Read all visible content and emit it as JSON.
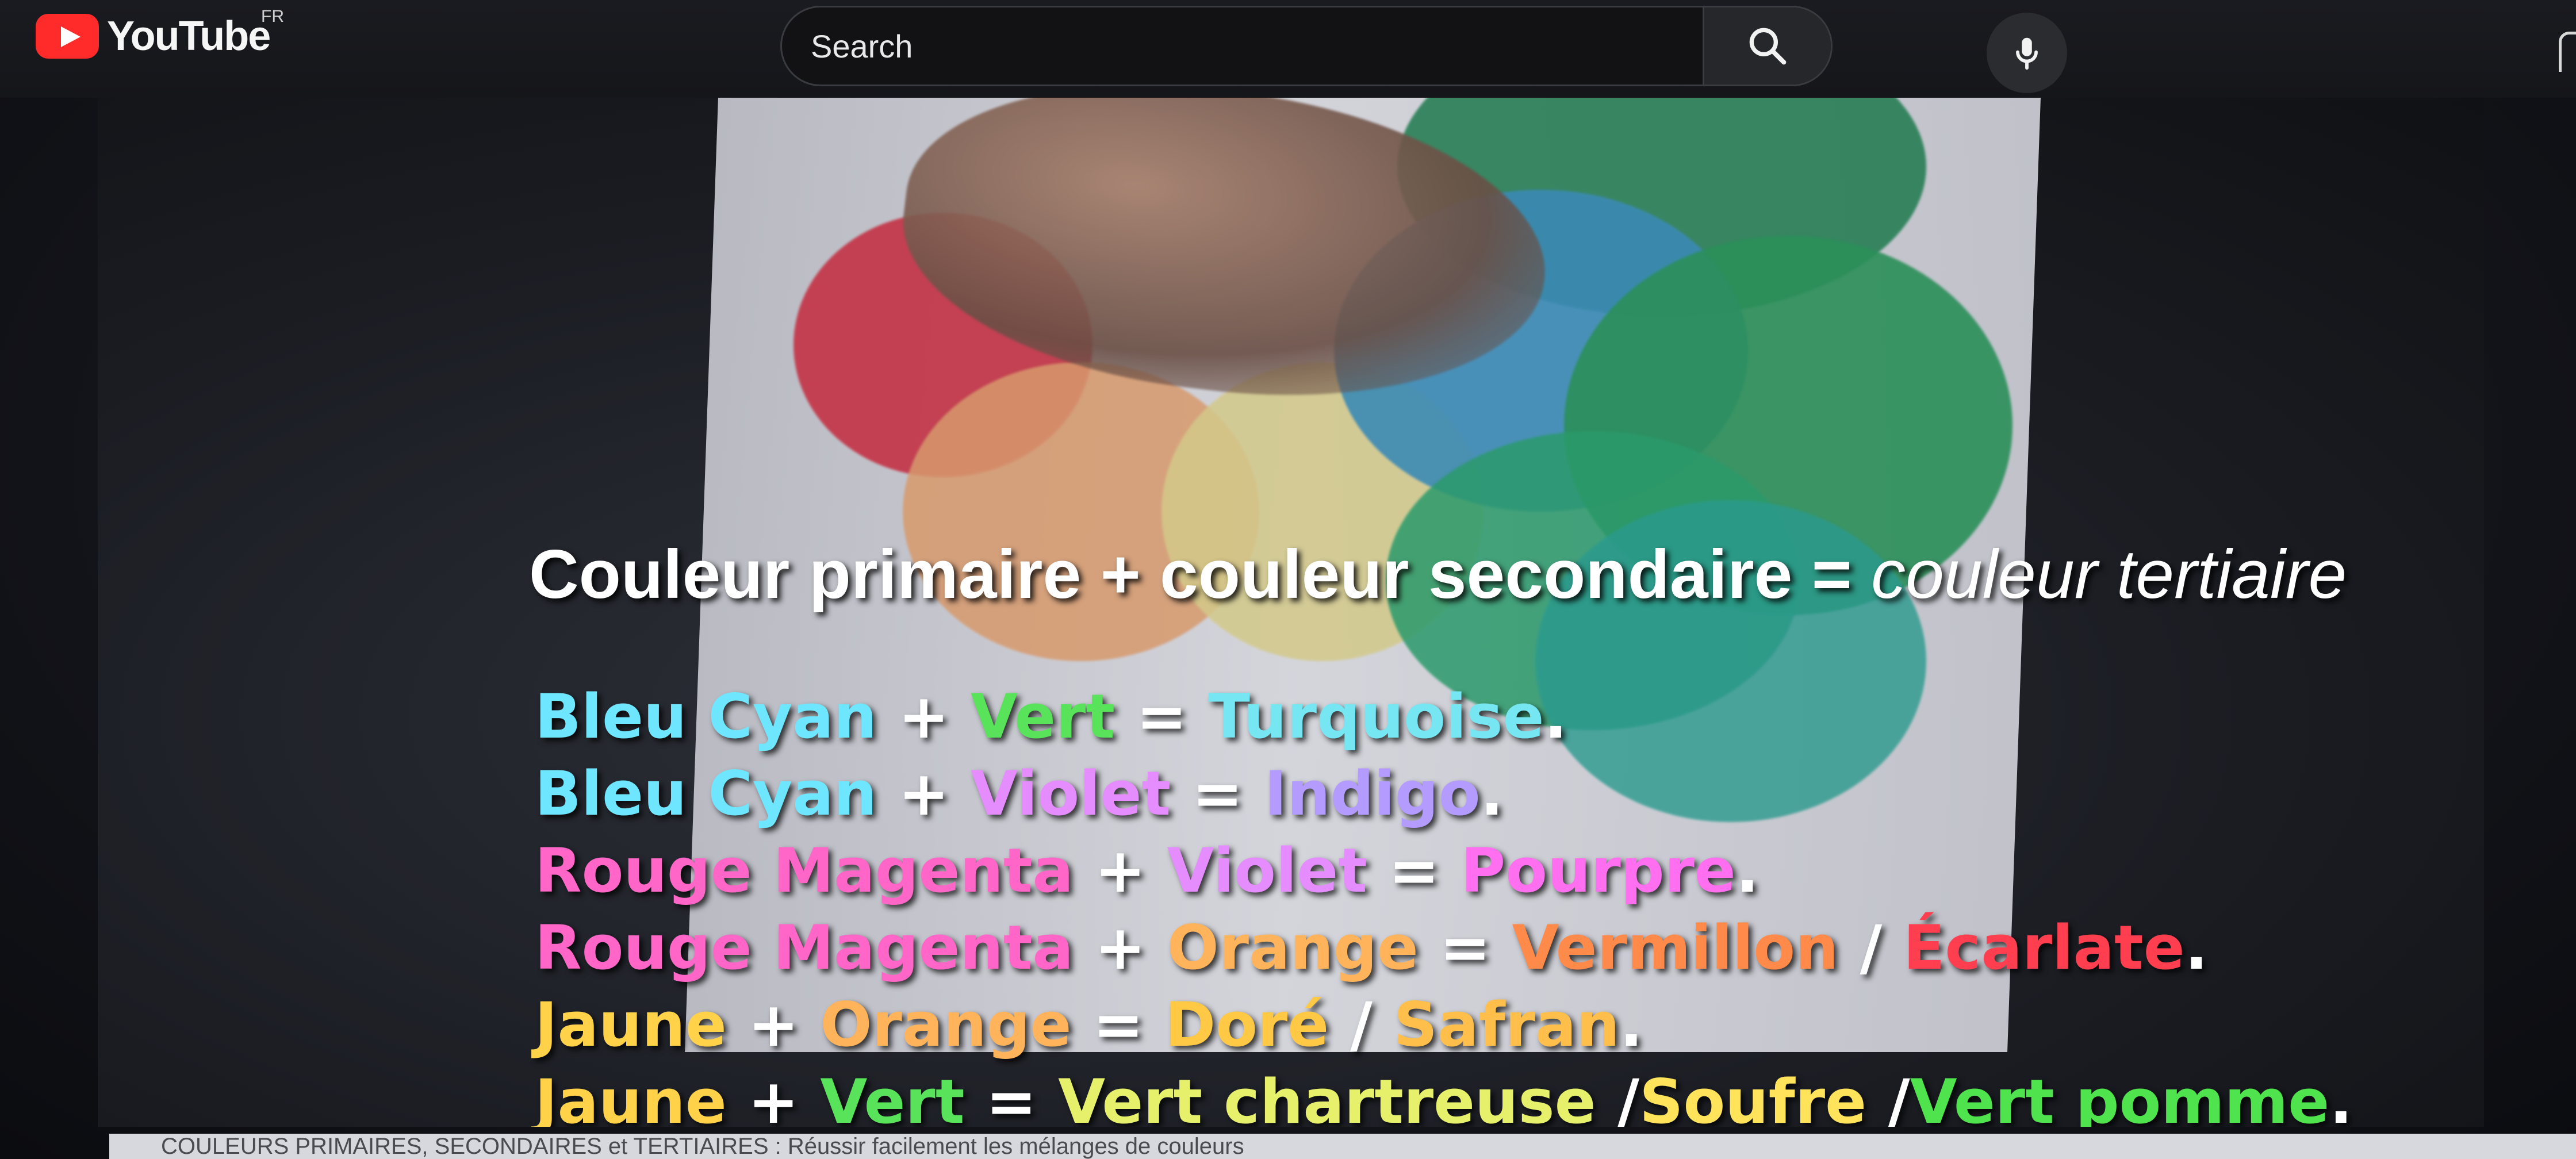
{
  "brand": {
    "name": "YouTube",
    "region": "FR",
    "color": "#ff2a2a"
  },
  "search": {
    "placeholder": "Search",
    "search_icon": "search-icon",
    "voice_icon": "microphone-icon"
  },
  "video": {
    "headline": {
      "part1": "Couleur primaire + couleur secondaire = ",
      "part2": "couleur tertiaire"
    },
    "formulas": [
      {
        "segments": [
          {
            "text": "Bleu Cyan",
            "color": "#6ee6ff"
          },
          {
            "text": " + ",
            "color": "#ffffff"
          },
          {
            "text": "Vert",
            "color": "#58e35a"
          },
          {
            "text": " = ",
            "color": "#ffffff"
          },
          {
            "text": "Turquoise",
            "color": "#76e6f3"
          },
          {
            "text": ".",
            "color": "#ffffff"
          }
        ]
      },
      {
        "segments": [
          {
            "text": "Bleu Cyan",
            "color": "#6ee6ff"
          },
          {
            "text": " + ",
            "color": "#ffffff"
          },
          {
            "text": "Violet",
            "color": "#e58cff"
          },
          {
            "text": " = ",
            "color": "#ffffff"
          },
          {
            "text": "Indigo",
            "color": "#b49bff"
          },
          {
            "text": ".",
            "color": "#ffffff"
          }
        ]
      },
      {
        "segments": [
          {
            "text": "Rouge Magenta",
            "color": "#ff66c8"
          },
          {
            "text": " + ",
            "color": "#ffffff"
          },
          {
            "text": "Violet",
            "color": "#e58cff"
          },
          {
            "text": " = ",
            "color": "#ffffff"
          },
          {
            "text": "Pourpre",
            "color": "#ff6ff0"
          },
          {
            "text": ".",
            "color": "#ffffff"
          }
        ]
      },
      {
        "segments": [
          {
            "text": "Rouge Magenta",
            "color": "#ff66c8"
          },
          {
            "text": " + ",
            "color": "#ffffff"
          },
          {
            "text": "Orange",
            "color": "#ffb35a"
          },
          {
            "text": " = ",
            "color": "#ffffff"
          },
          {
            "text": "Vermillon",
            "color": "#ff8a4a"
          },
          {
            "text": " / ",
            "color": "#ffffff"
          },
          {
            "text": "Écarlate",
            "color": "#ff3f4f"
          },
          {
            "text": ".",
            "color": "#ffffff"
          }
        ]
      },
      {
        "segments": [
          {
            "text": "Jaune",
            "color": "#ffd24a"
          },
          {
            "text": " + ",
            "color": "#ffffff"
          },
          {
            "text": "Orange",
            "color": "#ffb35a"
          },
          {
            "text": " = ",
            "color": "#ffffff"
          },
          {
            "text": "Doré",
            "color": "#ffc845"
          },
          {
            "text": " / ",
            "color": "#ffffff"
          },
          {
            "text": "Safran",
            "color": "#ffbf4a"
          },
          {
            "text": ".",
            "color": "#ffffff"
          }
        ]
      },
      {
        "segments": [
          {
            "text": "Jaune",
            "color": "#ffd24a"
          },
          {
            "text": " + ",
            "color": "#ffffff"
          },
          {
            "text": "Vert",
            "color": "#58e35a"
          },
          {
            "text": " = ",
            "color": "#ffffff"
          },
          {
            "text": "Vert chartreuse",
            "color": "#e6f06a"
          },
          {
            "text": " /",
            "color": "#ffffff"
          },
          {
            "text": "Soufre",
            "color": "#ffe35a"
          },
          {
            "text": " /",
            "color": "#ffffff"
          },
          {
            "text": "Vert pomme",
            "color": "#4fe34d"
          },
          {
            "text": ".",
            "color": "#ffffff"
          }
        ]
      }
    ]
  },
  "below_video_title": "COULEURS PRIMAIRES, SECONDAIRES et TERTIAIRES : Réussir facilement les mélanges de couleurs"
}
